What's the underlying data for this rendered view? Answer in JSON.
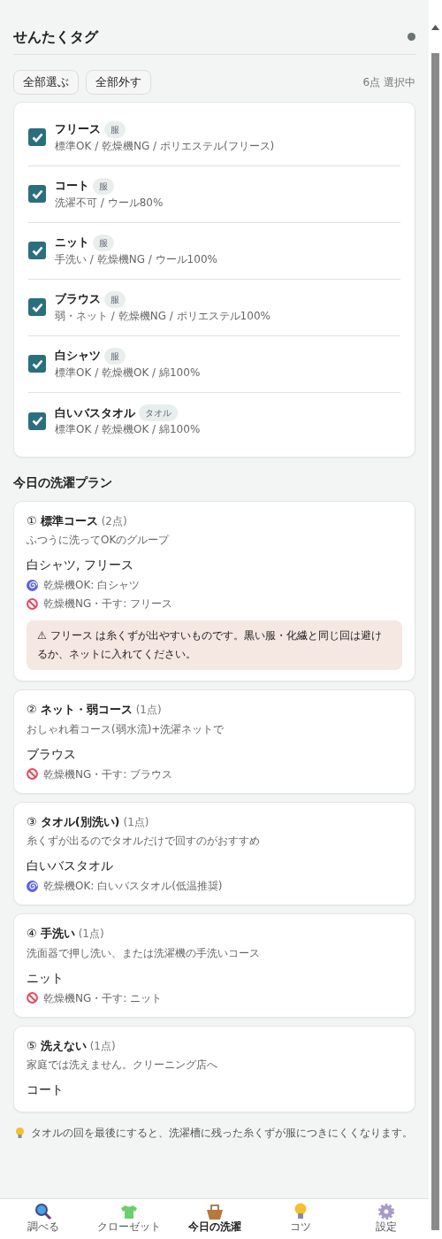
{
  "header": {
    "title": "せんたくタグ"
  },
  "actions": [
    "全部選ぶ",
    "全部外す"
  ],
  "selection_count": "6点 選択中",
  "items": [
    {
      "name": "フリース",
      "tag": "服",
      "details": "標準OK / 乾燥機NG / ポリエステル(フリース)",
      "checked": true
    },
    {
      "name": "コート",
      "tag": "服",
      "details": "洗濯不可 / ウール80%",
      "checked": true
    },
    {
      "name": "ニット",
      "tag": "服",
      "details": "手洗い / 乾燥機NG / ウール100%",
      "checked": true
    },
    {
      "name": "ブラウス",
      "tag": "服",
      "details": "弱・ネット / 乾燥機NG / ポリエステル100%",
      "checked": true
    },
    {
      "name": "白シャツ",
      "tag": "服",
      "details": "標準OK / 乾燥機OK / 綿100%",
      "checked": true
    },
    {
      "name": "白いバスタオル",
      "tag": "タオル",
      "details": "標準OK / 乾燥機OK / 綿100%",
      "checked": true
    }
  ],
  "plan": {
    "title": "今日の洗濯プラン",
    "courses": [
      {
        "number": "①",
        "name": "標準コース",
        "count": "(2点)",
        "description": "ふつうに洗ってOKのグループ",
        "items": "白シャツ, フリース",
        "notes": [
          {
            "kind": "dryer_ok",
            "text": "乾燥機OK: 白シャツ"
          },
          {
            "kind": "dryer_ng",
            "text": "乾燥機NG・干す: フリース"
          }
        ],
        "warning": "⚠ フリース は糸くずが出やすいものです。黒い服・化繊と同じ回は避けるか、ネットに入れてください。"
      },
      {
        "number": "②",
        "name": "ネット・弱コース",
        "count": "(1点)",
        "description": "おしゃれ着コース(弱水流)+洗濯ネットで",
        "items": "ブラウス",
        "notes": [
          {
            "kind": "dryer_ng",
            "text": "乾燥機NG・干す: ブラウス"
          }
        ]
      },
      {
        "number": "③",
        "name": "タオル(別洗い)",
        "count": "(1点)",
        "description": "糸くずが出るのでタオルだけで回すのがおすすめ",
        "items": "白いバスタオル",
        "notes": [
          {
            "kind": "dryer_ok",
            "text": "乾燥機OK: 白いバスタオル(低温推奨)"
          }
        ]
      },
      {
        "number": "④",
        "name": "手洗い",
        "count": "(1点)",
        "description": "洗面器で押し洗い、または洗濯機の手洗いコース",
        "items": "ニット",
        "notes": [
          {
            "kind": "dryer_ng",
            "text": "乾燥機NG・干す: ニット"
          }
        ]
      },
      {
        "number": "⑤",
        "name": "洗えない",
        "count": "(1点)",
        "description": "家庭では洗えません。クリーニング店へ",
        "items": "コート"
      }
    ]
  },
  "tip": "タオルの回を最後にすると、洗濯槽に残った糸くずが服につきにくくなります。",
  "nav": [
    {
      "kind": "search",
      "label": "調べる",
      "selected": false
    },
    {
      "kind": "shirt",
      "label": "クローゼット",
      "selected": false
    },
    {
      "kind": "basket",
      "label": "今日の洗濯",
      "selected": true
    },
    {
      "kind": "bulb",
      "label": "コツ",
      "selected": false
    },
    {
      "kind": "gear",
      "label": "設定",
      "selected": false
    }
  ]
}
